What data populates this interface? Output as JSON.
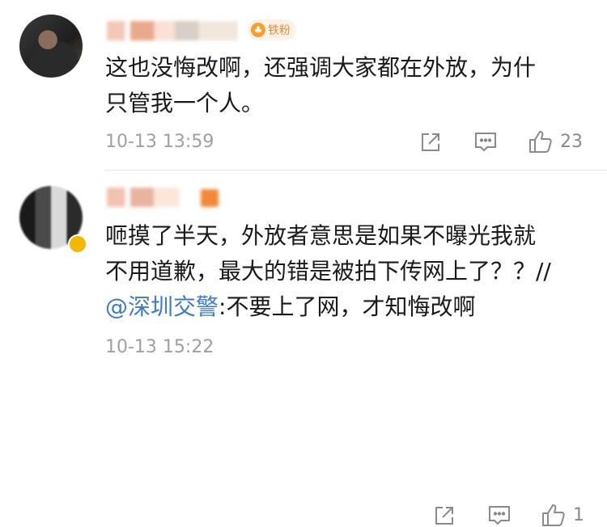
{
  "comments": [
    {
      "fan_badge": "铁粉",
      "text": "这也没悔改啊，还强调大家都在外放，为什\n只管我一个人。",
      "time": "10-13 13:59",
      "like_count": "23"
    },
    {
      "text_before": "咂摸了半天，外放者意思是如果不曝光我就\n不用道歉，最大的错是被拍下传网上了？？//\n",
      "mention": "@深圳交警",
      "text_after": ":不要上了网，才知悔改啊",
      "time": "10-13 15:22",
      "like_count": "1"
    }
  ],
  "icons": {
    "share": "share-icon",
    "reply": "comment-icon",
    "like": "thumbs-up-icon",
    "fan": "fan-badge-icon"
  },
  "colors": {
    "mention": "#3c7cc7",
    "badge": "#e8893a",
    "meta": "#a0a0a0"
  }
}
